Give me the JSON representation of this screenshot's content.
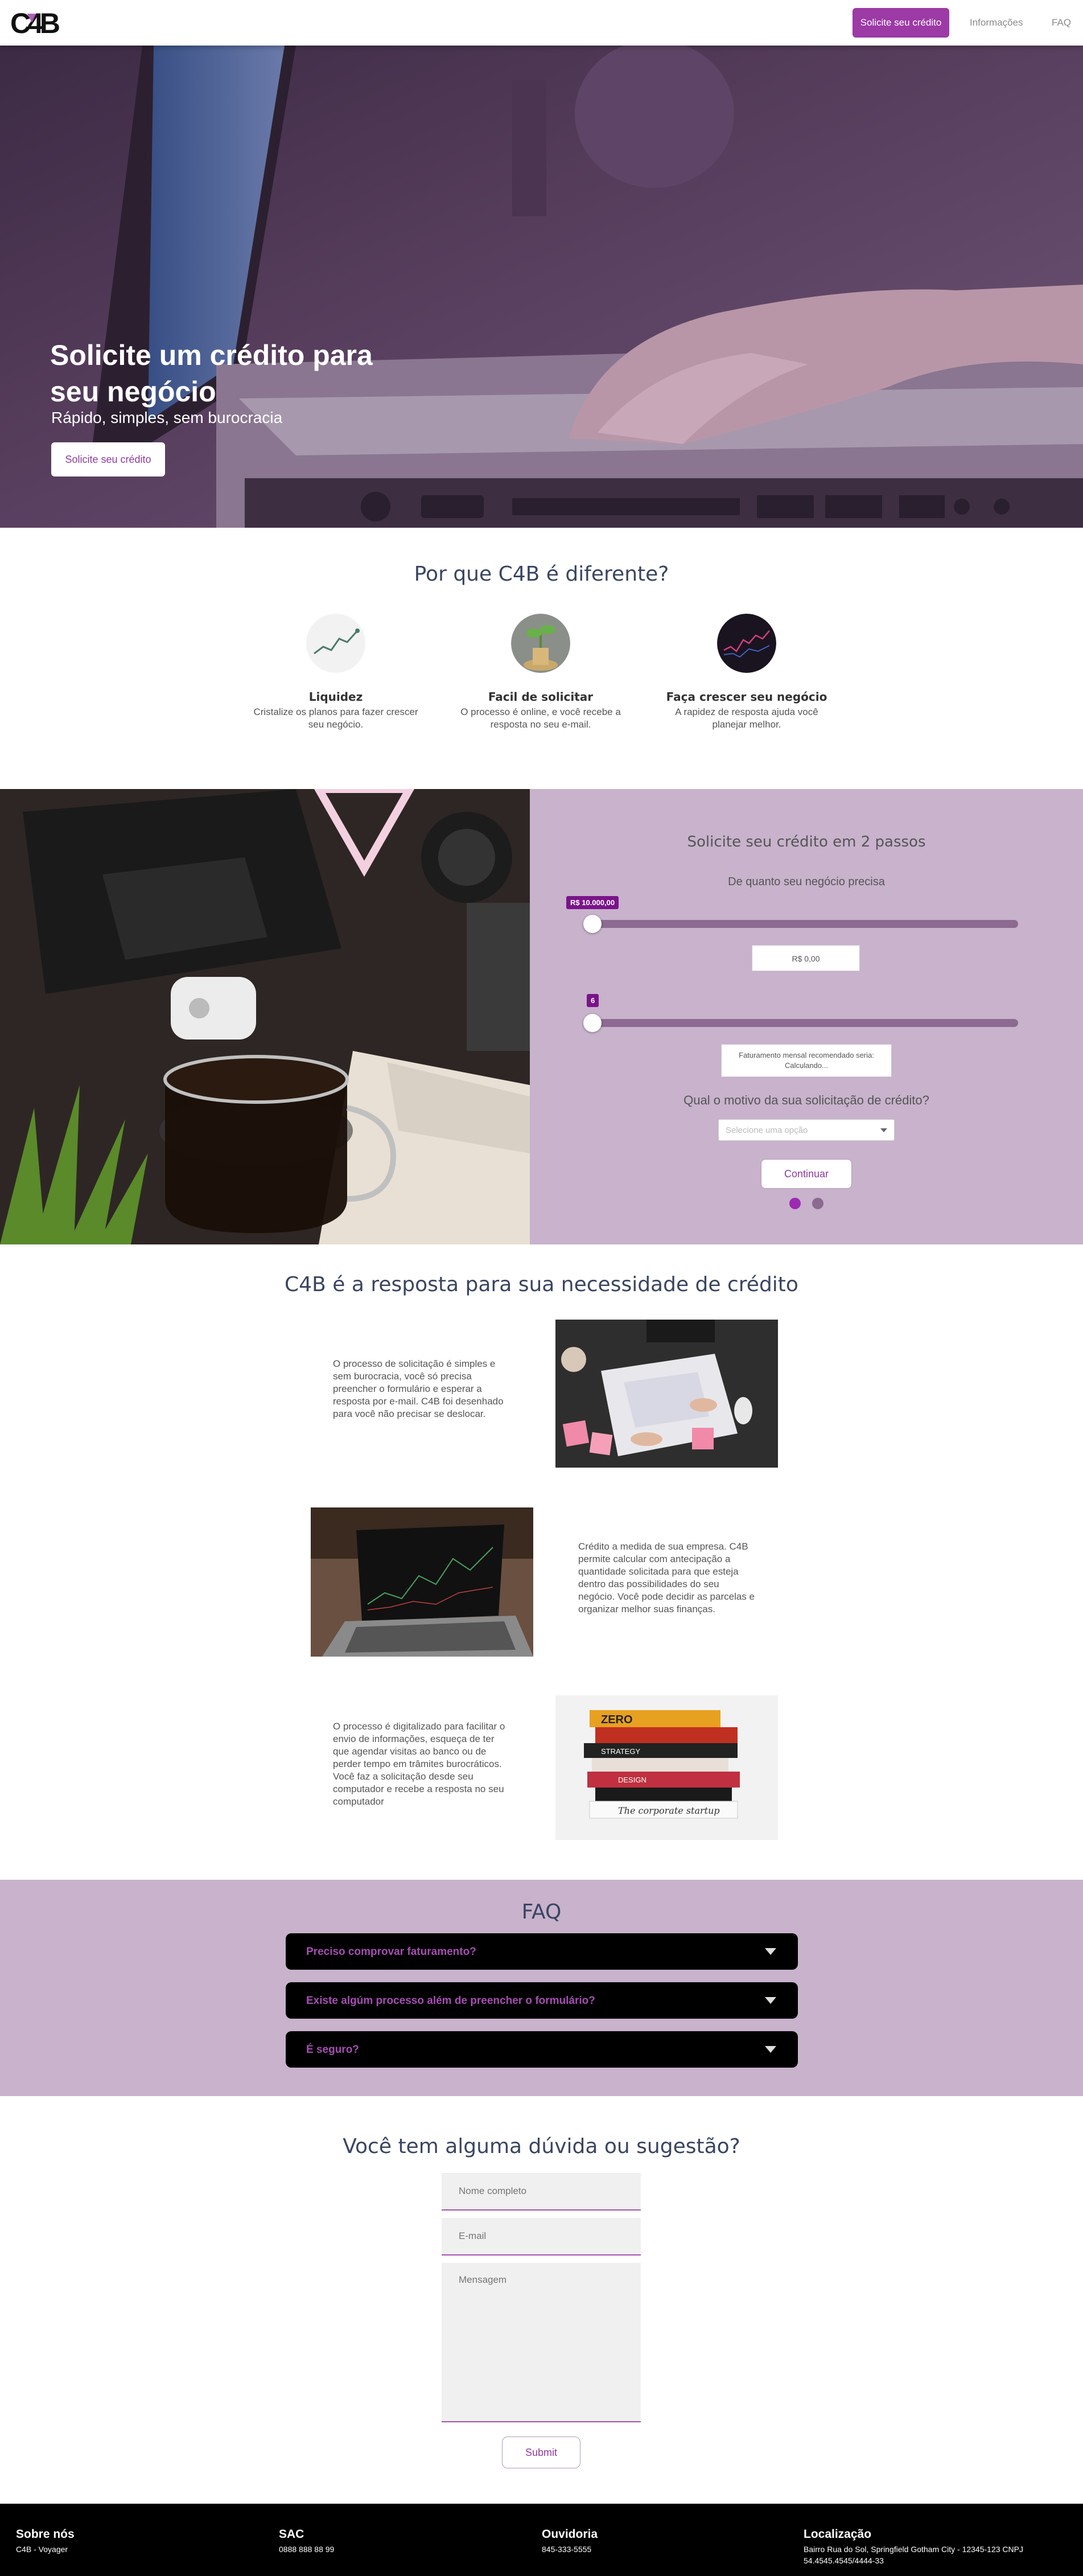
{
  "nav": {
    "logo": "C4B",
    "cta": "Solicite seu crédito",
    "info": "Informações",
    "faq": "FAQ"
  },
  "hero": {
    "title": "Solicite um crédito para seu negócio",
    "subtitle": "Rápido, simples, sem burocracia",
    "button": "Solicite seu crédito"
  },
  "why": {
    "title": "Por que C4B é diferente?",
    "features": [
      {
        "title": "Liquidez",
        "text": "Cristalize os planos para fazer crescer seu negócio."
      },
      {
        "title": "Facil de solicitar",
        "text": "O processo é online, e você recebe a resposta no seu e-mail."
      },
      {
        "title": "Faça crescer seu negócio",
        "text": "A rapidez de resposta ajuda você planejar melhor."
      }
    ]
  },
  "steps": {
    "title": "Solicite seu crédito em 2 passos",
    "question1": "De quanto seu negócio precisa",
    "slider1_tag": "R$ 10.000,00",
    "amount_value": "R$ 0,00",
    "slider2_tag": "6",
    "revenue_label": "Faturamento mensal recomendado seria:",
    "revenue_value": "Calculando...",
    "question2": "Qual o motivo da sua solicitação de crédito?",
    "select_placeholder": "Selecione uma opção",
    "continue": "Continuar",
    "active_step": 1
  },
  "answer": {
    "title": "C4B é a resposta para sua necessidade de crédito",
    "blocks": [
      "O processo de solicitação é simples e sem burocracia, você só precisa preencher o formulário e esperar a resposta por e-mail. C4B foi desenhado para você não precisar se deslocar.",
      "Crédito a medida de sua empresa. C4B permite calcular com antecipação a quantidade solicitada para que esteja dentro das possibilidades do seu negócio. Você pode decidir as parcelas e organizar melhor suas finanças.",
      "O processo é digitalizado para facilitar o envio de informações, esqueça de ter que agendar visitas ao banco ou de perder tempo em trâmites burocráticos. Você faz a solicitação desde seu computador e recebe a resposta no seu computador"
    ],
    "book_titles": [
      "ZERO",
      "STRATEGY",
      "DESIGN",
      "The corporate startup"
    ]
  },
  "faq": {
    "title": "FAQ",
    "items": [
      "Preciso comprovar faturamento?",
      "Existe algúm processo além de preencher o formulário?",
      "É seguro?"
    ]
  },
  "contact": {
    "title": "Você tem alguma dúvida ou sugestão?",
    "name_placeholder": "Nome completo",
    "email_placeholder": "E-mail",
    "message_placeholder": "Mensagem",
    "submit": "Submit"
  },
  "footer": {
    "about_title": "Sobre nós",
    "about_text": "C4B - Voyager",
    "sac_title": "SAC",
    "sac_text": "0888 888 88 99",
    "ouvidoria_title": "Ouvidoria",
    "ouvidoria_text": "845-333-5555",
    "location_title": "Localização",
    "location_text": "Bairro Rua do Sol, Springfield Gotham City - 12345-123 CNPJ 54.4545.4545/4444-33"
  },
  "colors": {
    "brand": "#9c3aa6",
    "lavender": "#c8b2cc",
    "dark": "#000000"
  }
}
